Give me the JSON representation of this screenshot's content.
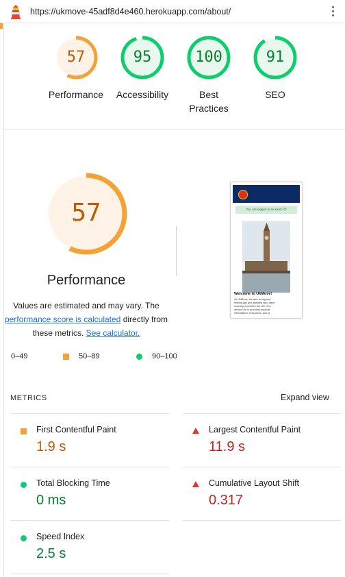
{
  "browser": {
    "url": "https://ukmove-45adf8d4e460.herokuapp.com/about/"
  },
  "scores": [
    {
      "name": "Performance",
      "score": "57",
      "value": 57,
      "color": "#f4a236",
      "bg": "#fff3e8",
      "text": "#c05a00"
    },
    {
      "name": "Accessibility",
      "score": "95",
      "value": 95,
      "color": "#0cce6b",
      "bg": "#e8f8ef",
      "text": "#08802f"
    },
    {
      "name": "Best\nPractices",
      "score": "100",
      "value": 100,
      "color": "#0cce6b",
      "bg": "#e8f8ef",
      "text": "#08802f"
    },
    {
      "name": "SEO",
      "score": "91",
      "value": 91,
      "color": "#0cce6b",
      "bg": "#e8f8ef",
      "text": "#08802f"
    }
  ],
  "performance": {
    "score": "57",
    "value": 57,
    "title": "Performance",
    "desc_part1": "Values are estimated and may vary. The",
    "desc_link1": "performance score is calculated",
    "desc_part2": "directly from",
    "desc_part3": "these metrics.",
    "desc_link2": "See calculator."
  },
  "screenshot": {
    "alert": "You are logged in as karen 😊",
    "welcome": "Welcome to UkMove!",
    "para": "At UkMove, we aim to support individuals and families who have recently moved to the UK. Our mission is to provide practical information, resources, and a"
  },
  "legend": [
    {
      "range": "0–49",
      "kind": "fail",
      "color": "#e23636"
    },
    {
      "range": "50–89",
      "kind": "average",
      "color": "#f4a236"
    },
    {
      "range": "90–100",
      "kind": "pass",
      "color": "#0cce6b"
    }
  ],
  "metrics": {
    "title": "METRICS",
    "expand_label": "Expand view",
    "items": [
      {
        "label": "First Contentful Paint",
        "value": "1.9 s",
        "status": "average",
        "color": "#c05a00"
      },
      {
        "label": "Largest Contentful Paint",
        "value": "11.9 s",
        "status": "fail",
        "color": "#c5221f"
      },
      {
        "label": "Total Blocking Time",
        "value": "0 ms",
        "status": "pass",
        "color": "#08802f"
      },
      {
        "label": "Cumulative Layout Shift",
        "value": "0.317",
        "status": "fail",
        "color": "#c5221f"
      },
      {
        "label": "Speed Index",
        "value": "2.5 s",
        "status": "pass",
        "color": "#08802f"
      }
    ]
  }
}
